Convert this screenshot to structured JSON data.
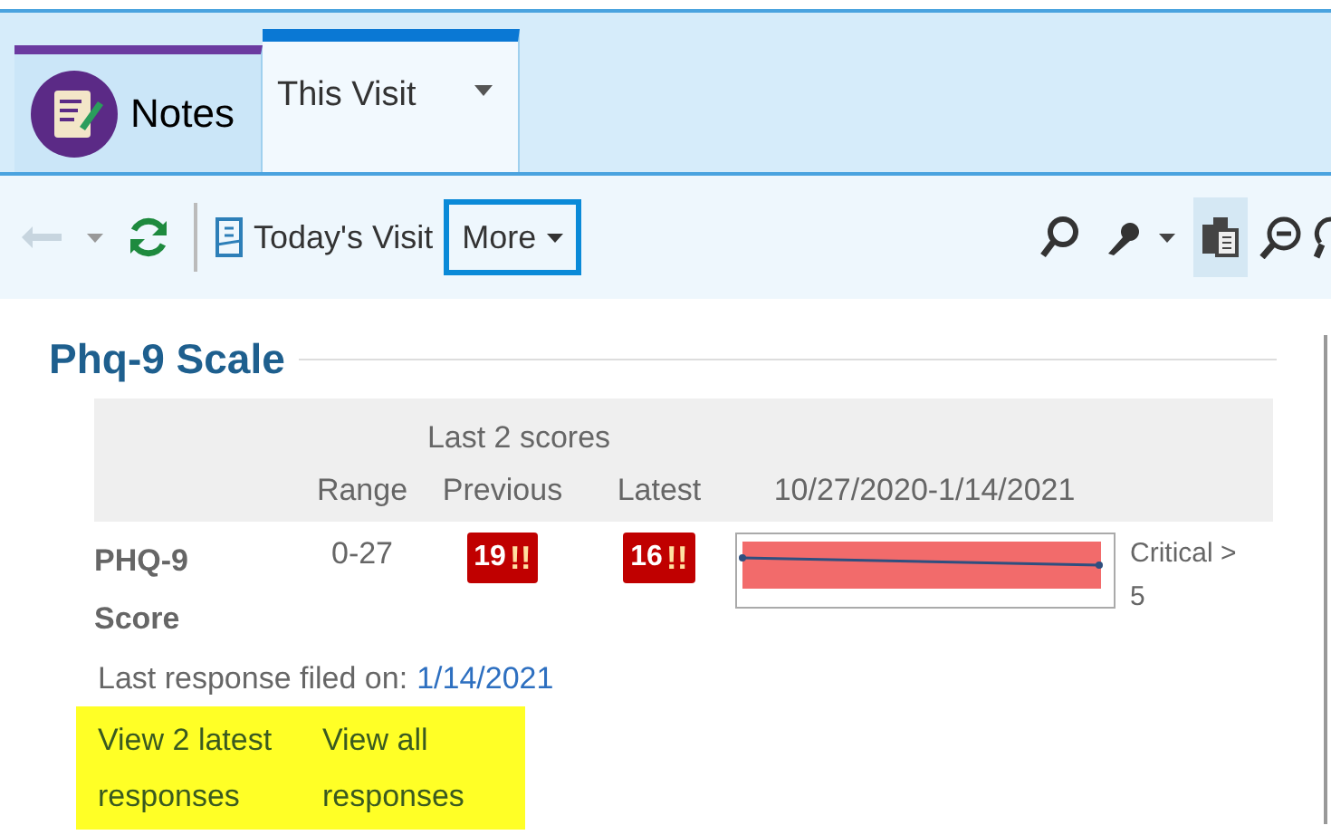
{
  "tabs": [
    {
      "kind": "app",
      "label": "Notes",
      "selected": false
    },
    {
      "kind": "menu",
      "label": "This Visit",
      "selected": true
    }
  ],
  "toolbar": {
    "back_disabled": true,
    "todays_visit": "Today's Visit",
    "more": {
      "label": "More",
      "focused": true
    }
  },
  "section": {
    "title": "Phq-9 Scale",
    "table": {
      "group_header": "Last 2 scores",
      "columns": [
        "Range",
        "Previous",
        "Latest",
        "10/27/2020-1/14/2021"
      ],
      "rows": [
        {
          "label": "PHQ-9 Score",
          "range": "0-27",
          "previous": {
            "value": "19",
            "flag": "!!"
          },
          "latest": {
            "value": "16",
            "flag": "!!"
          },
          "note": "Critical > 5"
        }
      ]
    },
    "last_response_label": "Last response filed on:",
    "last_response_date": "1/14/2021",
    "links": [
      {
        "label": "View 2 latest responses",
        "highlighted": true
      },
      {
        "label": "View all responses",
        "highlighted": true
      }
    ]
  }
}
